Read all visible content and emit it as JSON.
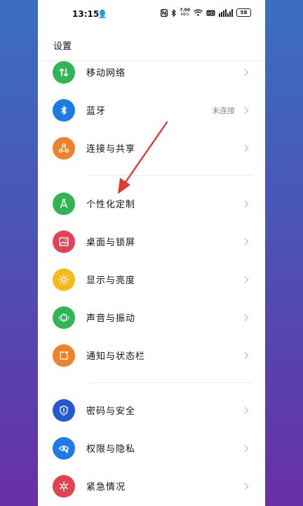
{
  "status_bar": {
    "time": "13:15",
    "speed": "7.00",
    "speed_unit": "KB/S",
    "battery": "58"
  },
  "header": {
    "title": "设置"
  },
  "settings": [
    {
      "key": "mobile-network",
      "label": "移动网络",
      "value": "",
      "icon": "arrows-updown-icon",
      "color": "#2fb553"
    },
    {
      "key": "bluetooth",
      "label": "蓝牙",
      "value": "未连接",
      "icon": "bluetooth-icon",
      "color": "#1e7be6"
    },
    {
      "key": "connection-sharing",
      "label": "连接与共享",
      "value": "",
      "icon": "share-nodes-icon",
      "color": "#f08128"
    },
    {
      "key": "personalization",
      "label": "个性化定制",
      "value": "",
      "icon": "compass-icon",
      "color": "#2fb553"
    },
    {
      "key": "desktop-lockscreen",
      "label": "桌面与锁屏",
      "value": "",
      "icon": "picture-icon",
      "color": "#e24354"
    },
    {
      "key": "display-brightness",
      "label": "显示与亮度",
      "value": "",
      "icon": "sun-icon",
      "color": "#f5b81d"
    },
    {
      "key": "sound-vibration",
      "label": "声音与振动",
      "value": "",
      "icon": "bell-icon",
      "color": "#2fb553"
    },
    {
      "key": "notification-statusbar",
      "label": "通知与状态栏",
      "value": "",
      "icon": "notification-icon",
      "color": "#f08128"
    },
    {
      "key": "password-security",
      "label": "密码与安全",
      "value": "",
      "icon": "shield-icon",
      "color": "#2459d6"
    },
    {
      "key": "permission-privacy",
      "label": "权限与隐私",
      "value": "",
      "icon": "eye-shield-icon",
      "color": "#1e7be6"
    },
    {
      "key": "emergency",
      "label": "紧急情况",
      "value": "",
      "icon": "asterisk-icon",
      "color": "#e24354"
    }
  ],
  "annotation": {
    "color": "#e23a2e"
  }
}
